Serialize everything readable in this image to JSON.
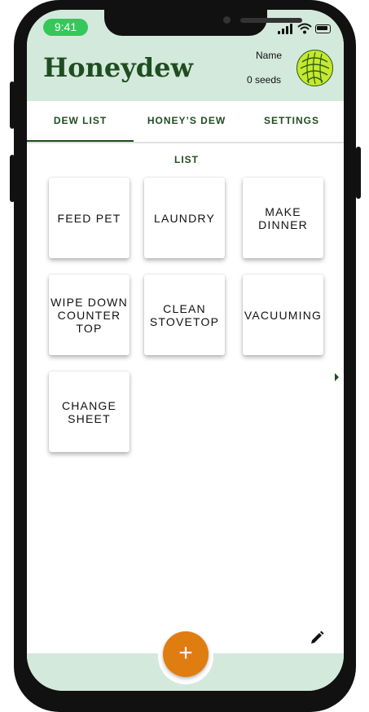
{
  "status_bar": {
    "time": "9:41"
  },
  "header": {
    "app_title": "Honeydew",
    "user_name": "Name",
    "seed_count": "0 seeds",
    "avatar_icon": "honeydew-melon-icon"
  },
  "tabs": [
    {
      "label": "DEW LIST",
      "active": true
    },
    {
      "label": "HONEY’S DEW LIST",
      "active": false
    },
    {
      "label": "SETTINGS",
      "active": false
    }
  ],
  "tasks": [
    {
      "label": "FEED PET"
    },
    {
      "label": "LAUNDRY"
    },
    {
      "label": "MAKE\nDINNER"
    },
    {
      "label": "WIPE DOWN\nCOUNTER\nTOP"
    },
    {
      "label": "CLEAN\nSTOVETOP"
    },
    {
      "label": "VACUUMING"
    },
    {
      "label": "CHANGE\nSHEET"
    }
  ],
  "actions": {
    "add_icon": "plus-icon",
    "add_symbol": "+",
    "edit_icon": "pencil-icon",
    "more_icon": "chevron-right-icon"
  },
  "colors": {
    "header_bg": "#d3e9dc",
    "brand_green": "#1f4d1f",
    "fab_orange": "#e07d10"
  }
}
